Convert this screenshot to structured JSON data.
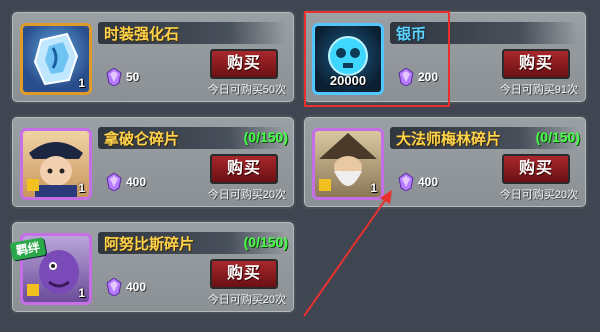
{
  "buy_label": "购买",
  "colors": {
    "name": "#ffd34a",
    "name_highlight": "#5fd4ff",
    "count": "#48ff48",
    "button": "#a8282c",
    "highlight_box": "#e8302e"
  },
  "items": [
    {
      "name": "时装强化石",
      "quantity": "1",
      "price": "50",
      "limit": "今日可购买50次",
      "count": "",
      "icon": "gem-crystal-icon"
    },
    {
      "name": "银币",
      "quantity": "20000",
      "price": "200",
      "limit": "今日可购买91次",
      "count": "",
      "icon": "silver-coin-skull-icon"
    },
    {
      "name": "拿破仑碎片",
      "quantity": "1",
      "price": "400",
      "limit": "今日可购买20次",
      "count": "(0/150)",
      "icon": "napoleon-portrait-icon"
    },
    {
      "name": "大法师梅林碎片",
      "quantity": "1",
      "price": "400",
      "limit": "今日可购买20次",
      "count": "(0/150)",
      "icon": "merlin-portrait-icon"
    },
    {
      "name": "阿努比斯碎片",
      "quantity": "1",
      "price": "400",
      "limit": "今日可购买20次",
      "count": "(0/150)",
      "icon": "anubis-portrait-icon",
      "badge": "羁绊"
    }
  ]
}
